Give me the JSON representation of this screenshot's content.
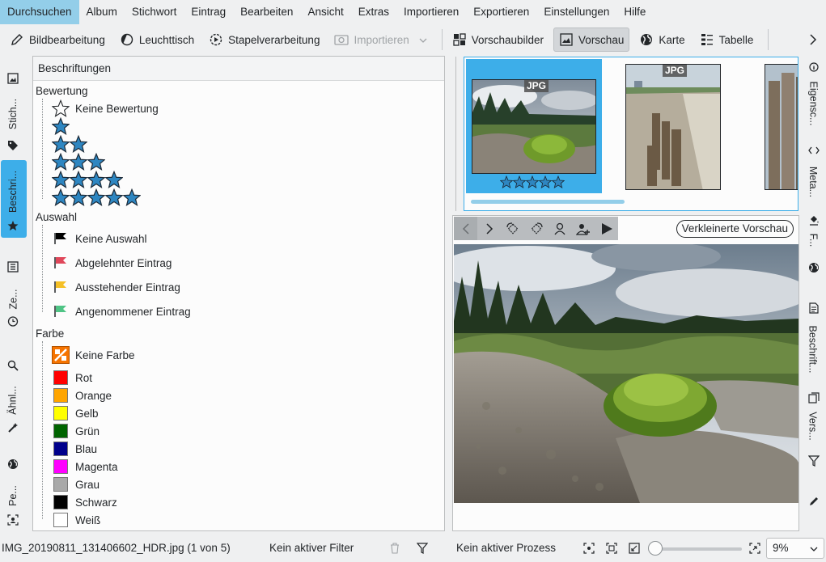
{
  "menu": {
    "items": [
      "Durchsuchen",
      "Album",
      "Stichwort",
      "Eintrag",
      "Bearbeiten",
      "Ansicht",
      "Extras",
      "Importieren",
      "Exportieren",
      "Einstellungen",
      "Hilfe"
    ],
    "active": "Durchsuchen"
  },
  "toolbar": {
    "image_editor": "Bildbearbeitung",
    "light_table": "Leuchttisch",
    "batch_queue": "Stapelverarbeitung",
    "import": "Importieren",
    "thumbnails": "Vorschaubilder",
    "preview": "Vorschau",
    "map": "Karte",
    "table": "Tabelle"
  },
  "left_tabs": {
    "tags": "Stich...",
    "labels": "Beschri...",
    "timeline": "Ze...",
    "similarity": "Ähnl...",
    "people": "Pe..."
  },
  "right_tabs": {
    "properties": "Eigensc...",
    "metadata": "Meta...",
    "filters": "F...",
    "captions": "Beschrift...",
    "versions": "Vers..."
  },
  "labels_panel": {
    "title": "Beschriftungen",
    "rating": {
      "header": "Bewertung",
      "none": "Keine Bewertung",
      "levels": [
        1,
        2,
        3,
        4,
        5
      ]
    },
    "pick": {
      "header": "Auswahl",
      "items": [
        {
          "label": "Keine Auswahl",
          "color": "#000000"
        },
        {
          "label": "Abgelehnter Eintrag",
          "color": "#e0475a"
        },
        {
          "label": "Ausstehender Eintrag",
          "color": "#f5c026"
        },
        {
          "label": "Angenommener Eintrag",
          "color": "#4fc485"
        }
      ]
    },
    "color": {
      "header": "Farbe",
      "none": "Keine Farbe",
      "items": [
        {
          "label": "Rot",
          "color": "#ff0000"
        },
        {
          "label": "Orange",
          "color": "#ffa500"
        },
        {
          "label": "Gelb",
          "color": "#ffff00"
        },
        {
          "label": "Grün",
          "color": "#006400"
        },
        {
          "label": "Blau",
          "color": "#00008b"
        },
        {
          "label": "Magenta",
          "color": "#ff00ff"
        },
        {
          "label": "Grau",
          "color": "#a9a9a9"
        },
        {
          "label": "Schwarz",
          "color": "#000000"
        },
        {
          "label": "Weiß",
          "color": "#ffffff"
        }
      ]
    }
  },
  "thumbnails": {
    "badge": "JPG",
    "selected_rating": 5
  },
  "preview": {
    "reduced_button": "Verkleinerte Vorschau"
  },
  "status": {
    "file": "IMG_20190811_131406602_HDR.jpg (1 von 5)",
    "filter": "Kein aktiver Filter",
    "process": "Kein aktiver Prozess",
    "zoom": "9%",
    "zoom_slider_fraction": 0.0
  },
  "colors": {
    "accent": "#3daee9",
    "star": "#2e86c1"
  }
}
